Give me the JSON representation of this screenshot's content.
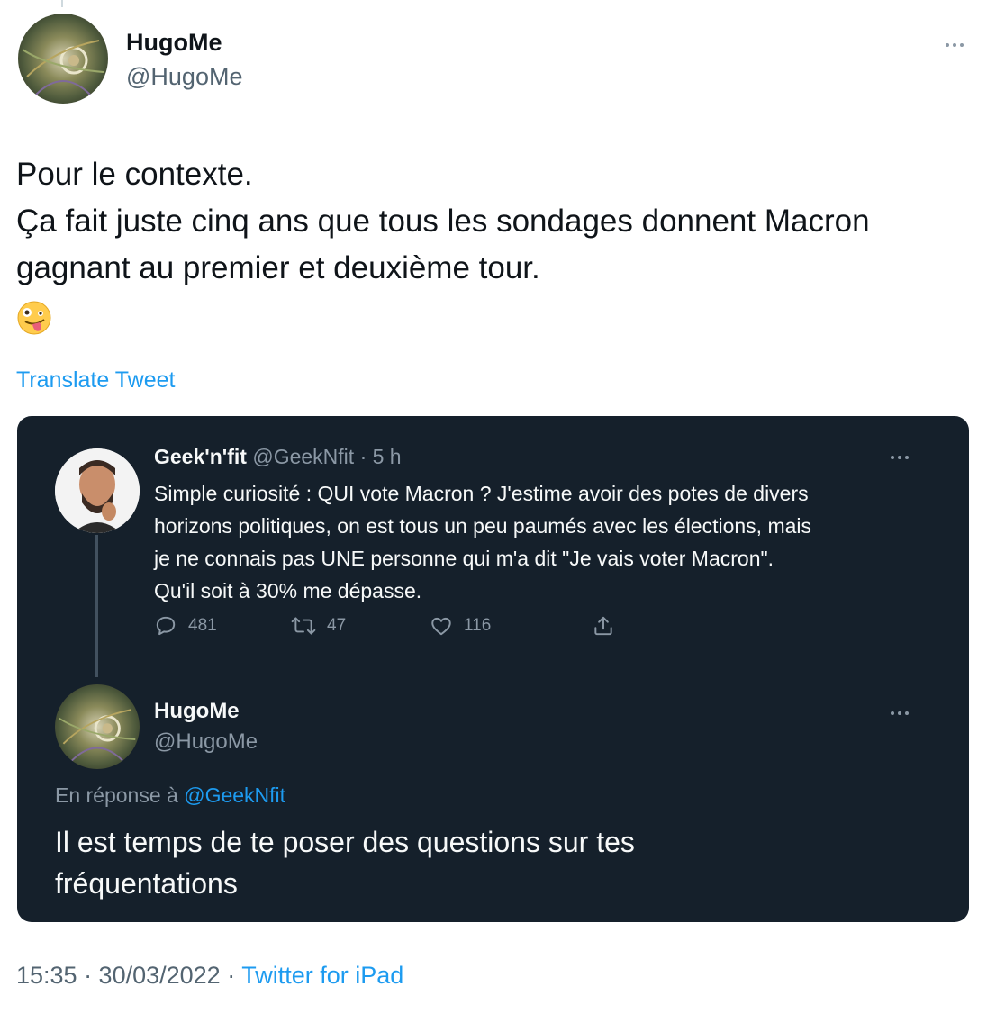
{
  "tweet": {
    "author": {
      "name": "HugoMe",
      "handle": "@HugoMe"
    },
    "text_lines": [
      "Pour le contexte.",
      "Ça fait juste cinq ans que tous les sondages donnent Macron",
      "gagnant au premier et deuxième tour."
    ],
    "emoji": "zany-face-emoji",
    "translate_label": "Translate Tweet",
    "timestamp": "15:35 · 30/03/2022 · ",
    "source": "Twitter for iPad"
  },
  "quote": {
    "original": {
      "name": "Geek'n'fit",
      "handle": "@GeekNfit",
      "age": "· 5 h",
      "text_lines": [
        "Simple curiosité : QUI vote Macron ? J'estime avoir des potes de divers",
        "horizons politiques, on est tous un peu paumés avec les élections, mais",
        "je ne connais pas UNE personne qui m'a dit \"Je vais voter Macron\".",
        "Qu'il soit à 30% me dépasse."
      ],
      "stats": {
        "replies": "481",
        "retweets": "47",
        "likes": "116"
      }
    },
    "reply": {
      "name": "HugoMe",
      "handle": "@HugoMe",
      "replying_prefix": "En réponse à ",
      "replying_to": "@GeekNfit",
      "text_lines": [
        "Il est temps de te poser des questions sur tes",
        "fréquentations"
      ]
    }
  },
  "colors": {
    "accent": "#1d9bf0",
    "card_bg": "#15202b",
    "secondary_text": "#536471"
  }
}
